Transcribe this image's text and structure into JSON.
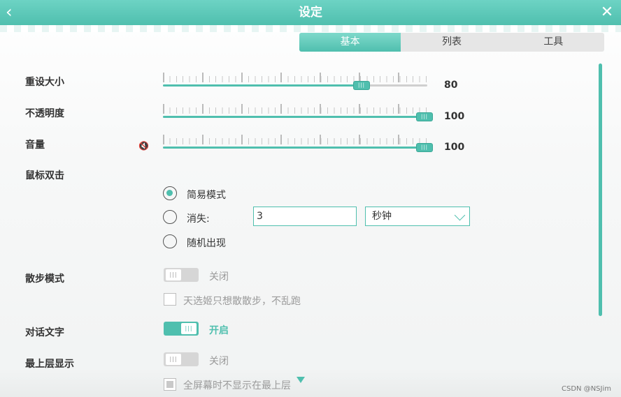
{
  "window": {
    "title": "设定"
  },
  "tabs": [
    {
      "label": "基本",
      "active": true
    },
    {
      "label": "列表",
      "active": false
    },
    {
      "label": "工具",
      "active": false
    }
  ],
  "settings": {
    "resize": {
      "label": "重设大小",
      "value": "80",
      "level": 0.75
    },
    "opacity": {
      "label": "不透明度",
      "value": "100",
      "level": 1.0
    },
    "volume": {
      "label": "音量",
      "value": "100",
      "level": 1.0
    },
    "double_click": {
      "label": "鼠标双击",
      "options": {
        "simple": {
          "label": "简易模式",
          "selected": true
        },
        "disappear": {
          "label": "消失:",
          "selected": false,
          "input_value": "3",
          "unit": "秒钟"
        },
        "random": {
          "label": "随机出现",
          "selected": false
        }
      }
    },
    "walk_mode": {
      "label": "散步模式",
      "state_text": "关闭",
      "checkbox_label": "天选姬只想散散步，不乱跑"
    },
    "dialog_text": {
      "label": "对话文字",
      "state_text": "开启"
    },
    "topmost": {
      "label": "最上层显示",
      "state_text": "关闭",
      "checkbox_label": "全屏幕时不显示在最上层"
    }
  },
  "watermark": "CSDN @NSJim",
  "colors": {
    "accent": "#4fbfae",
    "off": "#d6d6d6"
  },
  "icons": {
    "back": "chevron-left-icon",
    "close": "close-icon",
    "volume": "speaker-mute-icon"
  }
}
